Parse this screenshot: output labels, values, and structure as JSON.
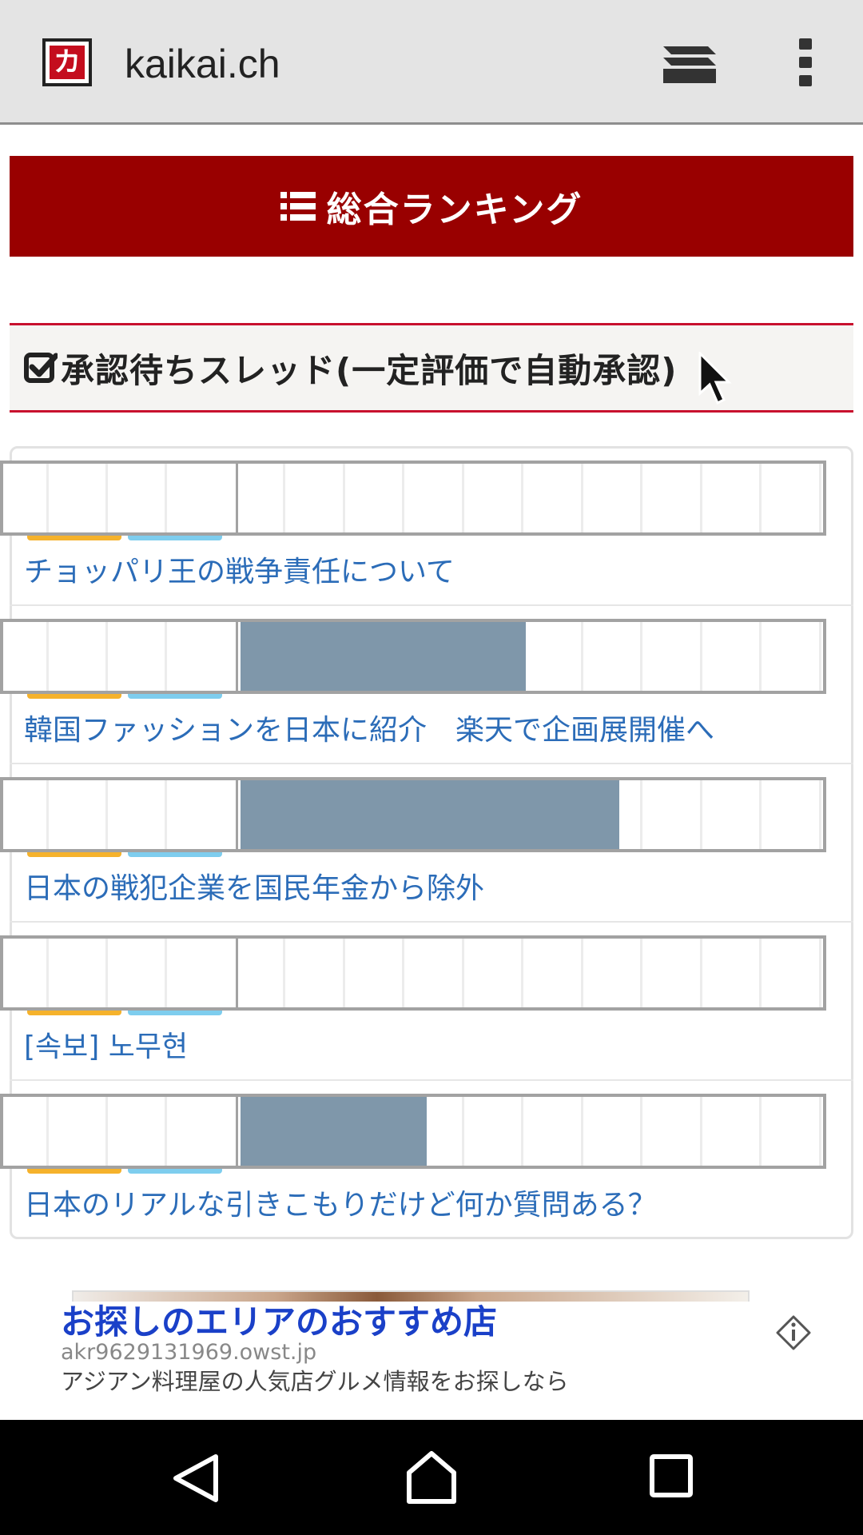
{
  "browser": {
    "site_icon_glyph": "カ",
    "url": "kaikai.ch",
    "tabs_icon": "tabs-icon",
    "menu_icon": "more-vert-icon"
  },
  "ranking_button": {
    "icon": "list-icon",
    "label": "総合ランキング"
  },
  "section": {
    "icon": "checkbox-icon",
    "title": "承認待ちスレッド(一定評価で自動承認)"
  },
  "threads": [
    {
      "title": "チョッパリ王の戦争責任について",
      "rating_fraction": 0.0
    },
    {
      "title": "韓国ファッションを日本に紹介　楽天で企画展開催へ",
      "rating_fraction": 0.49
    },
    {
      "title": "日本の戦犯企業を国民年金から除外",
      "rating_fraction": 0.65
    },
    {
      "title": "[속보] 노무현",
      "rating_fraction": 0.0
    },
    {
      "title": "日本のリアルな引きこもりだけど何か質問ある？",
      "rating_fraction": 0.32
    }
  ],
  "ad": {
    "title": "お探しのエリアのおすすめ店",
    "url": "akr9629131969.owst.jp",
    "description": "アジアン料理屋の人気店グルメ情報をお探しなら",
    "info_icon": "ad-info-icon"
  },
  "navigation": {
    "back_icon": "back-icon",
    "home_icon": "home-icon",
    "recent_icon": "recent-apps-icon"
  },
  "colors": {
    "rank_button_bg": "#990000",
    "section_border": "#c8102e",
    "thread_link": "#2b6cb8",
    "rating_fill": "#7f97aa",
    "tag_orange": "#f5b22c",
    "tag_blue": "#7ecdee",
    "ad_title": "#1a40c8"
  }
}
